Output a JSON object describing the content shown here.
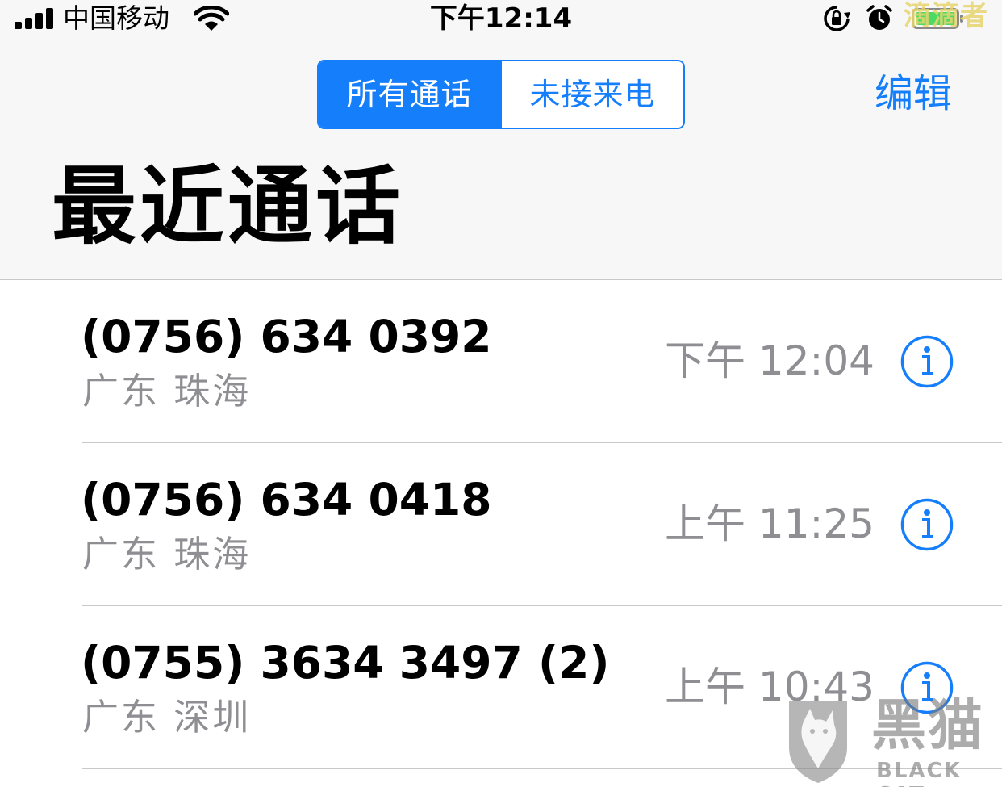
{
  "status_bar": {
    "carrier": "中国移动",
    "time": "下午12:14",
    "icons": [
      "signal-bars-icon",
      "wifi-icon",
      "rotation-lock-icon",
      "alarm-icon",
      "battery-icon"
    ],
    "watermark_top": "滴滴者"
  },
  "segmented_control": {
    "options": [
      {
        "label": "所有通话",
        "selected": true
      },
      {
        "label": "未接来电",
        "selected": false
      }
    ]
  },
  "nav": {
    "edit_label": "编辑",
    "title": "最近通话"
  },
  "calls": [
    {
      "number": "(0756) 634 0392",
      "location": "广东 珠海",
      "time": "下午 12:04",
      "icon": "info-icon"
    },
    {
      "number": "(0756) 634 0418",
      "location": "广东 珠海",
      "time": "上午 11:25",
      "icon": "info-icon"
    },
    {
      "number": "(0755) 3634 3497 (2)",
      "location": "广东 深圳",
      "time": "上午 10:43",
      "icon": "info-icon"
    }
  ],
  "watermark": {
    "name_cn": "黑猫",
    "name_en": "BLACK CAT"
  },
  "colors": {
    "accent": "#147efb",
    "secondary_text": "#8e8e93",
    "header_background": "#f7f7f7",
    "separator": "#c8c7cc"
  }
}
